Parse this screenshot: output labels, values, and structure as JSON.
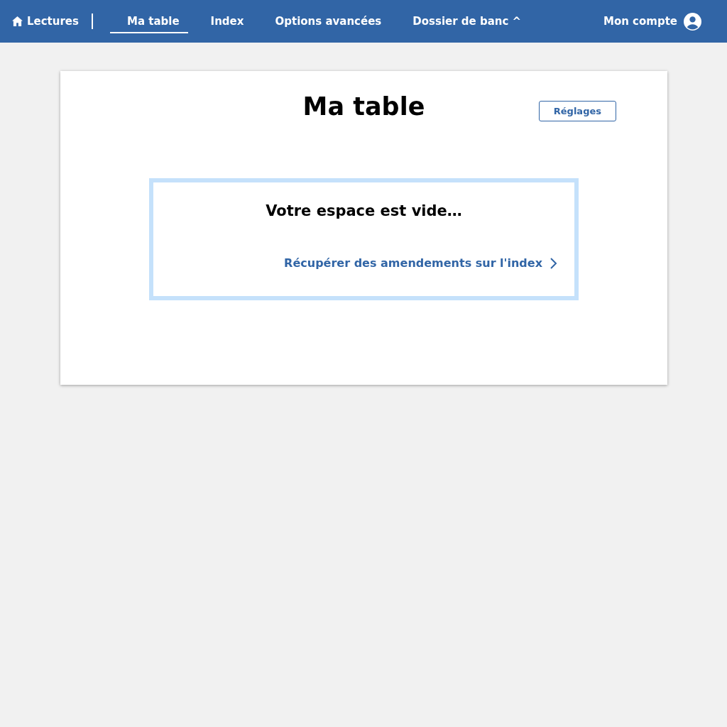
{
  "nav": {
    "home": {
      "label": "Lectures"
    },
    "tabs": [
      {
        "label": "Ma table",
        "selected": true
      },
      {
        "label": "Index",
        "selected": false
      },
      {
        "label": "Options avancées",
        "selected": false
      },
      {
        "label": "Dossier de banc ^",
        "selected": false
      }
    ],
    "account": {
      "label": "Mon compte"
    }
  },
  "page": {
    "title": "Ma table",
    "settings_button": "Réglages",
    "empty_state": {
      "message": "Votre espace est vide…",
      "link": "Récupérer des amendements sur l'index"
    }
  }
}
